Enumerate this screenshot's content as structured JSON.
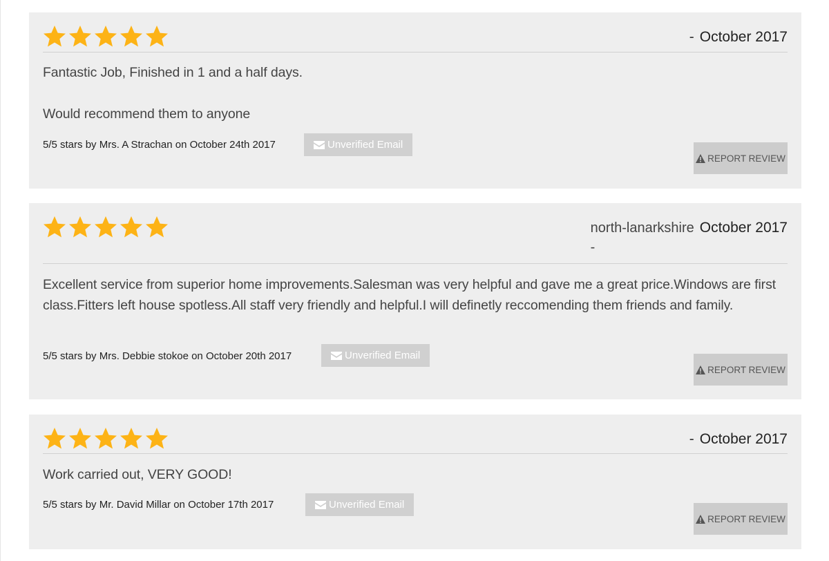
{
  "colors": {
    "star": "#FDB316",
    "card_bg": "#EEEEEE",
    "badge_bg": "#D0D0D0",
    "button_bg": "#CCCCCC"
  },
  "reviews": [
    {
      "rating": 5,
      "max_rating": 5,
      "location": "",
      "dash": "-",
      "date_label": "October 2017",
      "body": [
        "Fantastic Job, Finished in 1 and a half days.",
        "Would recommend them to anyone"
      ],
      "byline": "5/5 stars by Mrs. A Strachan on October 24th 2017",
      "badge_label": "Unverified Email",
      "badge_icon": "envelope-icon",
      "report_label": "REPORT REVIEW",
      "report_icon": "warning-icon"
    },
    {
      "rating": 5,
      "max_rating": 5,
      "location": "north-lanarkshire",
      "dash": "-",
      "date_label": "October 2017",
      "body": [
        "Excellent service from superior home improvements.Salesman was very helpful and gave me a great price.Windows are first class.Fitters left house  spotless.All staff very friendly and helpful.I will definetly reccomending them friends and family."
      ],
      "byline": "5/5 stars by Mrs. Debbie stokoe on October 20th 2017",
      "badge_label": "Unverified Email",
      "badge_icon": "envelope-icon",
      "report_label": "REPORT REVIEW",
      "report_icon": "warning-icon"
    },
    {
      "rating": 5,
      "max_rating": 5,
      "location": "",
      "dash": "-",
      "date_label": "October 2017",
      "body": [
        "Work carried out, VERY GOOD!"
      ],
      "byline": "5/5 stars by Mr. David Millar on October 17th 2017",
      "badge_label": "Unverified Email",
      "badge_icon": "envelope-icon",
      "report_label": "REPORT REVIEW",
      "report_icon": "warning-icon"
    }
  ]
}
